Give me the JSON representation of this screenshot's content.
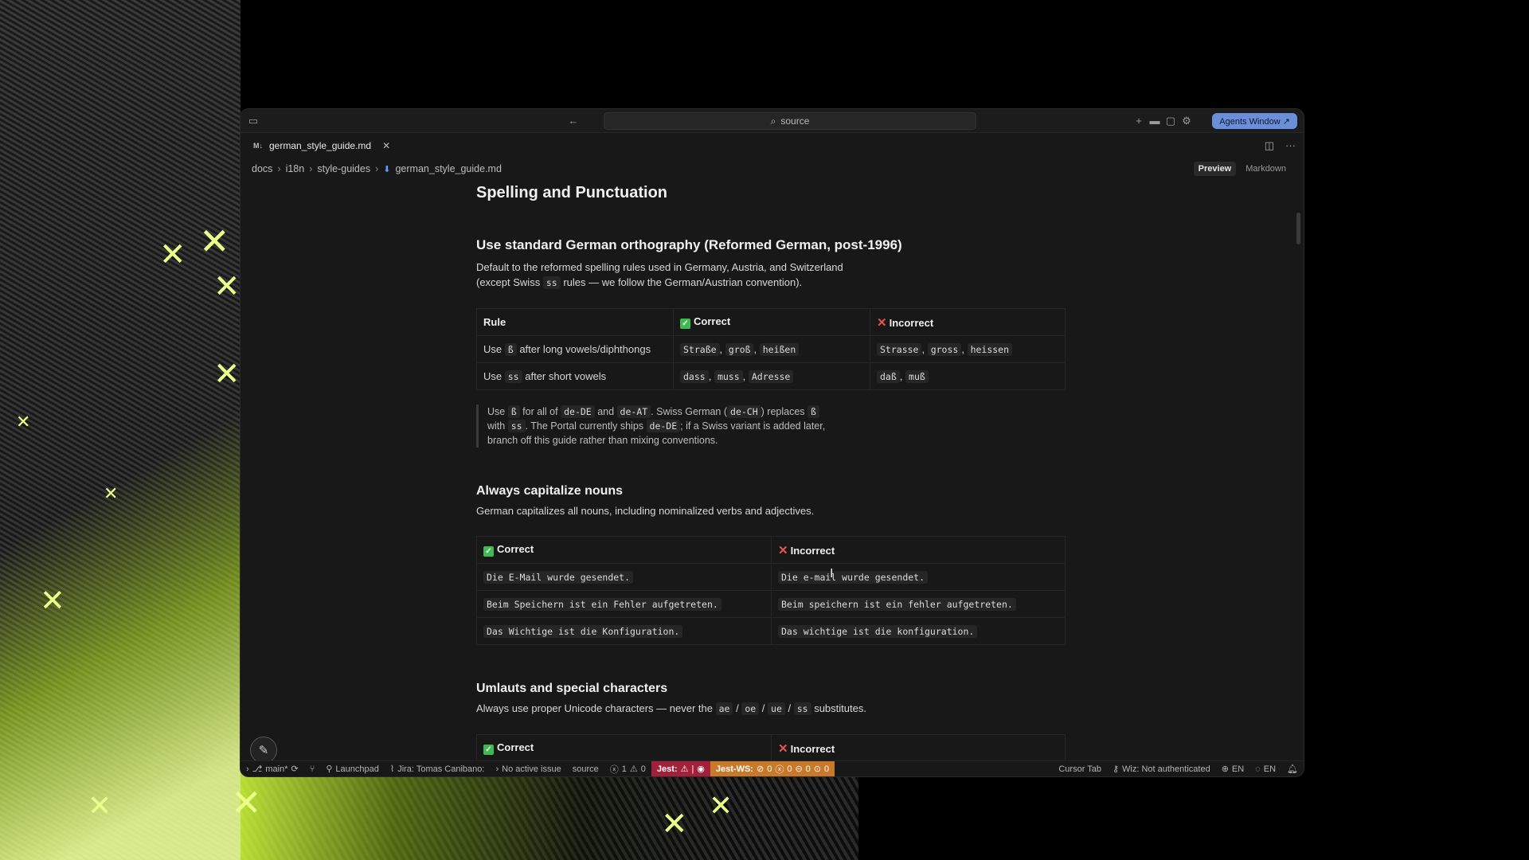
{
  "window": {
    "search_text": "source",
    "agents_button": "Agents Window ↗"
  },
  "tab": {
    "md_icon": "M↓",
    "filename": "german_style_guide.md"
  },
  "breadcrumb": [
    "docs",
    "i18n",
    "style-guides",
    "german_style_guide.md"
  ],
  "view_modes": {
    "preview": "Preview",
    "markdown": "Markdown"
  },
  "doc": {
    "h_spelling": "Spelling and Punctuation",
    "h_ortho": "Use standard German orthography (Reformed German, post-1996)",
    "p_ortho_1": "Default to the reformed spelling rules used in Germany, Austria, and Switzerland",
    "p_ortho_2a": "(except Swiss",
    "p_ortho_2code": "ss",
    "p_ortho_2b": "rules — we follow the German/Austrian convention).",
    "table1": {
      "headers": [
        "Rule",
        "Correct",
        "Incorrect"
      ],
      "row1": {
        "a": "Use",
        "a_code": "ß",
        "b": "after long vowels/diphthongs",
        "correct": [
          "Straße",
          "groß",
          "heißen"
        ],
        "incorrect": [
          "Strasse",
          "gross",
          "heissen"
        ]
      },
      "row2": {
        "a": "Use",
        "a_code": "ss",
        "b": "after short vowels",
        "correct": [
          "dass",
          "muss",
          "Adresse"
        ],
        "incorrect": [
          "daß",
          "muß"
        ]
      }
    },
    "quote": {
      "t1": "Use",
      "c1": "ß",
      "t2": "for all of",
      "c2": "de-DE",
      "t3": "and",
      "c3": "de-AT",
      "t4": ". Swiss German (",
      "c4": "de-CH",
      "t5": ") replaces",
      "c5": "ß",
      "t6": "with",
      "c6": "ss",
      "t7": ". The Portal currently ships",
      "c7": "de-DE",
      "t8": "; if a Swiss variant is added",
      "t9": "later, branch off this guide rather than mixing conventions."
    },
    "h_nouns": "Always capitalize nouns",
    "p_nouns": "German capitalizes all nouns, including nominalized verbs and adjectives.",
    "table2": {
      "headers": [
        "Correct",
        "Incorrect"
      ],
      "rows": [
        [
          "Die E-Mail wurde gesendet.",
          "Die e-mail wurde gesendet."
        ],
        [
          "Beim Speichern ist ein Fehler aufgetreten.",
          "Beim speichern ist ein fehler aufgetreten."
        ],
        [
          "Das Wichtige ist die Konfiguration.",
          "Das wichtige ist die konfiguration."
        ]
      ]
    },
    "h_umlauts": "Umlauts and special characters",
    "p_umlauts_a": "Always use proper Unicode characters — never the",
    "p_umlauts_codes": [
      "ae",
      "oe",
      "ue",
      "ss"
    ],
    "p_umlauts_b": "substitutes.",
    "table3": {
      "headers": [
        "Correct",
        "Incorrect"
      ]
    }
  },
  "statusbar": {
    "branch": "main*",
    "launchpad": "Launchpad",
    "jira": "Jira: Tomas Canibano:",
    "issue": "No active issue",
    "source": "source",
    "errors": "1",
    "warnings": "0",
    "jest": "Jest:",
    "jestws": "Jest-WS:",
    "jestws_counts": [
      "0",
      "0",
      "0",
      "0"
    ],
    "cursor_tab": "Cursor Tab",
    "wiz": "Wiz: Not authenticated",
    "lang1": "EN",
    "lang2": "EN"
  }
}
